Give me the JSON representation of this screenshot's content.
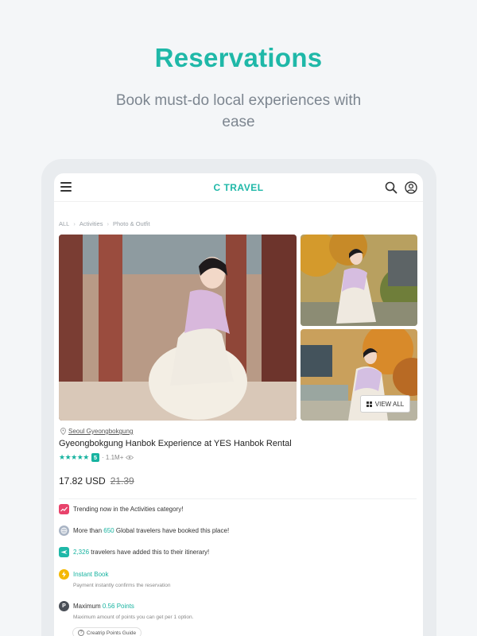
{
  "hero": {
    "title": "Reservations",
    "subtitle": "Book must-do local experiences with ease"
  },
  "app": {
    "logo": "C TRAVEL",
    "icons": [
      "menu-icon",
      "search-icon",
      "user-icon"
    ]
  },
  "breadcrumbs": [
    "ALL",
    "Activities",
    "Photo & Outfit"
  ],
  "gallery": {
    "view_all_label": "VIEW ALL"
  },
  "product": {
    "location": "Seoul Gyeongbokgung",
    "title": "Gyeongbokgung Hanbok Experience at YES Hanbok Rental",
    "stars": "★★★★★",
    "rating_score": "5",
    "views": "· 1.1M+",
    "price_current": "17.82 USD",
    "price_original": "21.39"
  },
  "info": {
    "trending": "Trending now in the Activities category!",
    "booked_prefix": "More than",
    "booked_count": "650",
    "booked_suffix": "Global travelers have booked this place!",
    "itinerary_count": "2,326",
    "itinerary_suffix": "travelers have added this to their itinerary!",
    "instant_book": "Instant Book",
    "instant_book_sub": "Payment instantly confirms the reservation",
    "points_prefix": "Maximum",
    "points_value": "0.56 Points",
    "points_sub": "Maximum amount of points you can get per 1 option.",
    "guide_label": "Creatrip Points Guide"
  },
  "colors": {
    "brand": "#1fb8a8",
    "trending": "#e8436b",
    "global": "#a9b4c4",
    "itinerary": "#1fb8a8",
    "instant": "#f5b800",
    "points": "#4a4f57"
  }
}
